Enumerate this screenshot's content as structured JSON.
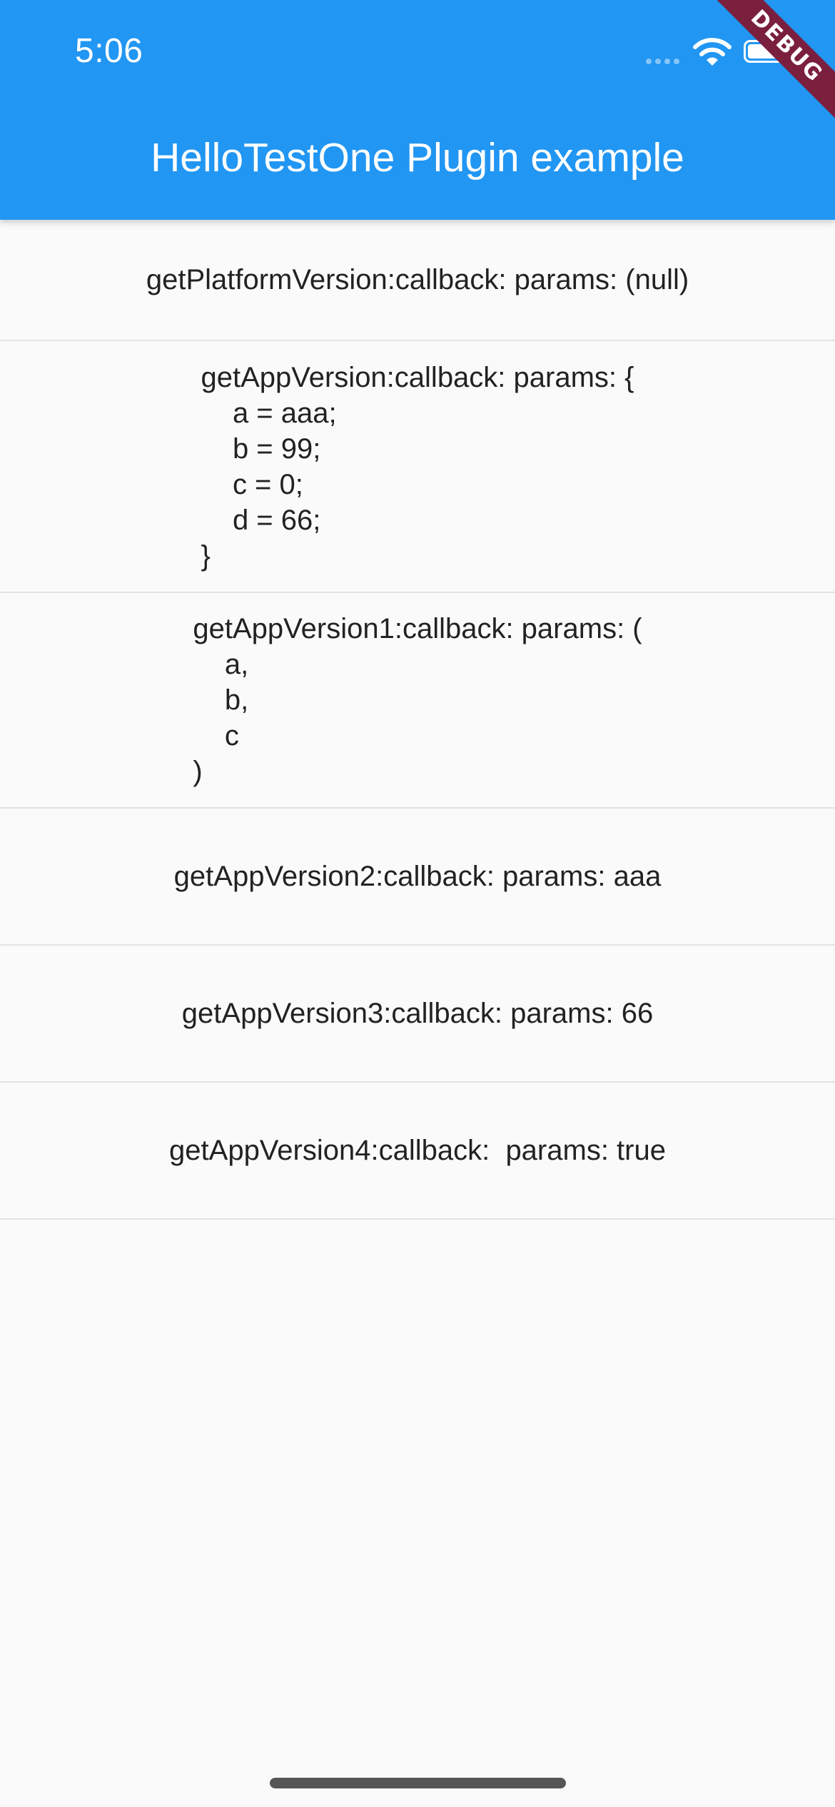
{
  "status_bar": {
    "time": "5:06"
  },
  "app_bar": {
    "title": "HelloTestOne Plugin example",
    "color": "#2196f3"
  },
  "debug_banner": {
    "label": "DEBUG",
    "color": "#7b1f3f"
  },
  "results": [
    {
      "text": "getPlatformVersion:callback: params: (null)"
    },
    {
      "text": "getAppVersion:callback: params: {\n    a = aaa;\n    b = 99;\n    c = 0;\n    d = 66;\n}"
    },
    {
      "text": "getAppVersion1:callback: params: (\n    a,\n    b,\n    c\n)"
    },
    {
      "text": "getAppVersion2:callback: params: aaa"
    },
    {
      "text": "getAppVersion3:callback: params: 66"
    },
    {
      "text": "getAppVersion4:callback:  params: true"
    }
  ],
  "icons": [
    "cellular-signal-icon",
    "wifi-icon",
    "battery-icon"
  ]
}
